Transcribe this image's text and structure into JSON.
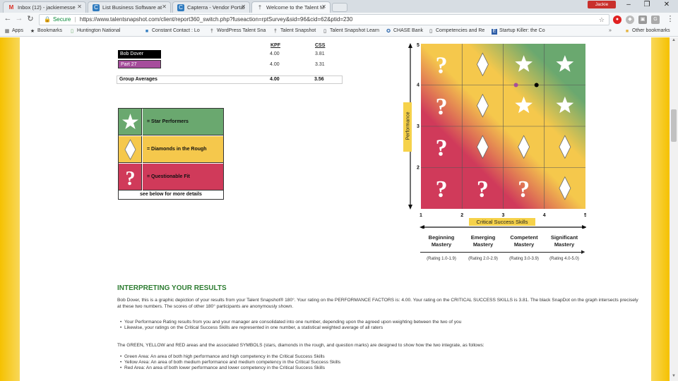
{
  "browser": {
    "tabs": [
      {
        "label": "Inbox (12) - jackiemesse",
        "icon": "gmail-icon",
        "color": "#d93025"
      },
      {
        "label": "List Business Software at",
        "icon": "capterra-icon",
        "color": "#2f7bbf"
      },
      {
        "label": "Capterra - Vendor Portal",
        "icon": "capterra-icon",
        "color": "#2f7bbf"
      },
      {
        "label": "Welcome to the Talent M",
        "icon": "snapshot-icon",
        "color": "#555555"
      }
    ],
    "profile": "Jackie",
    "url_secure": "Secure",
    "url": "https://www.talentsnapshot.com/client/report360_switch.php?fuseaction=rptSurvey&sid=96&cid=62&ptid=230",
    "bookmarks": [
      "Apps",
      "Bookmarks",
      "Huntington National",
      "Constant Contact : Lo",
      "WordPress Talent Sna",
      "Talent Snapshot",
      "Talent Snapshot Learn",
      "CHASE Bank",
      "Competencies and Re",
      "Startup Killer: the Co"
    ],
    "other_bookmarks": "Other bookmarks"
  },
  "scores": {
    "kpf_header": "KPF",
    "css_header": "CSS",
    "rows": [
      {
        "name": "Bob Dover",
        "kpf": "4.00",
        "css": "3.81",
        "color": "#000000"
      },
      {
        "name": "Part 27",
        "kpf": "4.00",
        "css": "3.31",
        "color": "#a64d9c"
      }
    ],
    "group": {
      "label": "Group Averages",
      "kpf": "4.00",
      "css": "3.56"
    }
  },
  "legend": {
    "items": [
      {
        "label": "= Star Performers",
        "color": "#6aa86f"
      },
      {
        "label": "= Diamonds in the Rough",
        "color": "#f5c84c"
      },
      {
        "label": "= Questionable Fit",
        "color": "#d03a5a"
      }
    ],
    "footer": "see below for more details"
  },
  "chart_data": {
    "type": "scatter",
    "xlabel": "Critical Success Skills",
    "ylabel": "Performance",
    "xlim": [
      1,
      5
    ],
    "ylim": [
      1,
      5
    ],
    "x_ticks": [
      "1",
      "2",
      "3",
      "4",
      "5"
    ],
    "y_ticks": [
      "2",
      "3",
      "4",
      "5"
    ],
    "grid_symbols": [
      [
        "?",
        "diamond",
        "star",
        "star"
      ],
      [
        "?",
        "diamond",
        "star",
        "star"
      ],
      [
        "?",
        "diamond",
        "diamond",
        "diamond"
      ],
      [
        "?",
        "?",
        "?",
        "diamond"
      ]
    ],
    "points": [
      {
        "x": 3.81,
        "y": 4.0,
        "color": "#000000"
      },
      {
        "x": 3.31,
        "y": 4.0,
        "color": "#a64d9c"
      }
    ]
  },
  "mastery": {
    "columns": [
      {
        "title": "Beginning Mastery",
        "rating": "(Rating 1.0-1.9)"
      },
      {
        "title": "Emerging Mastery",
        "rating": "(Rating 2.0-2.9)"
      },
      {
        "title": "Competent Mastery",
        "rating": "(Rating 3.0-3.9)"
      },
      {
        "title": "Significant Mastery",
        "rating": "(Rating 4.0-5.0)"
      }
    ]
  },
  "content": {
    "title": "INTERPRETING YOUR RESULTS",
    "intro": "Bob Dover, this is a graphic depiction of your results from your Talent Snapshot® 180°. Your rating on the PERFORMANCE FACTORS is: 4.00. Your rating on the CRITICAL SUCCESS SKILLS is 3.81. The black SnapDot on the graph intersects precisely at these two numbers. The scores of other 180° participants are anonymously shown.",
    "bullets1": [
      "Your Performance Rating results from you and your manager are consolidated into one number, depending upon the agreed upon weighting between the two of you",
      "Likewise, your ratings on the Critical Success Skills are represented in one number, a statistical weighted average of all raters"
    ],
    "para2": "The GREEN, YELLOW and RED areas and the associated SYMBOLS (stars, diamonds in the rough, and question marks) are designed to show how the two integrate, as follows:",
    "bullets2": [
      "Green Area: An area of both high performance and high competency in the Critical Success Skills",
      "Yellow Area: An area of both medium performance and medium competency in the Critical Success Skills",
      "Red Area: An area of both lower performance and lower competency in the Critical Success Skills"
    ]
  }
}
